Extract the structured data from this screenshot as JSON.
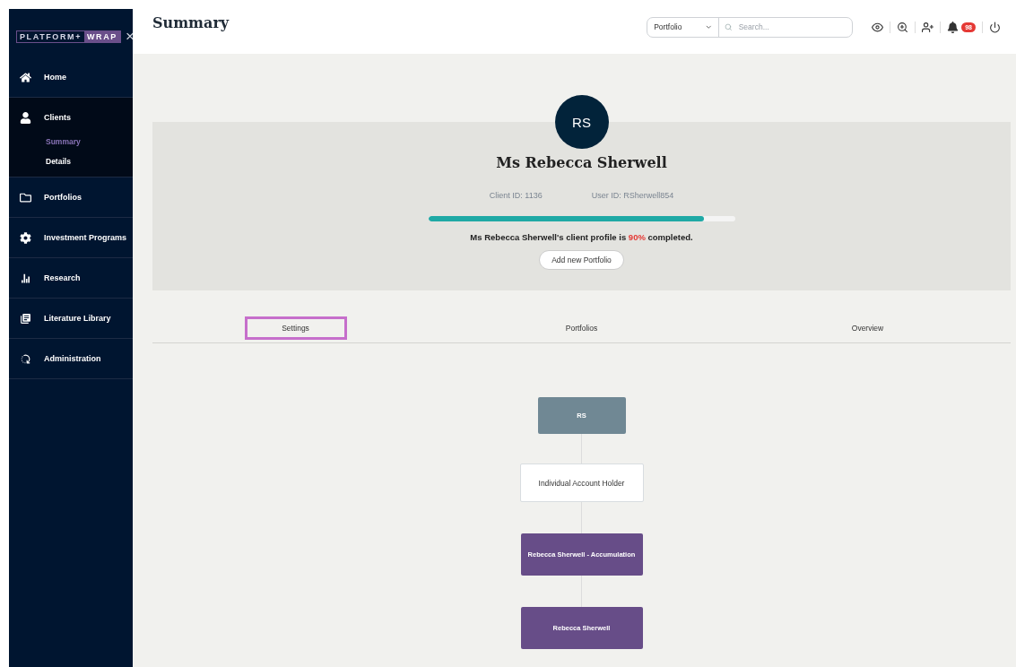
{
  "logo": {
    "left": "PLATFORM",
    "plus": "+",
    "right": "WRAP",
    "close": "×"
  },
  "sidebar": {
    "items": [
      {
        "label": "Home",
        "expanded": false
      },
      {
        "label": "Clients",
        "expanded": true,
        "children": [
          {
            "label": "Summary",
            "selected": true
          },
          {
            "label": "Details",
            "selected": false
          }
        ]
      },
      {
        "label": "Portfolios",
        "expanded": false
      },
      {
        "label": "Investment Programs",
        "expanded": false
      },
      {
        "label": "Research",
        "expanded": false
      },
      {
        "label": "Literature Library",
        "expanded": false
      },
      {
        "label": "Administration",
        "expanded": false
      }
    ]
  },
  "header": {
    "title": "Summary",
    "scope": "Portfolio",
    "search_placeholder": "Search...",
    "notifications": "98"
  },
  "profile": {
    "initials": "RS",
    "name": "Ms Rebecca Sherwell",
    "client_id": "Client ID: 1136",
    "user_id": "User ID: RSherwell854",
    "level": 0.9,
    "completion": "Ms Rebecca Sherwell's client profile is **90%** completed.",
    "button": "Add new Portfolio"
  },
  "tabs": [
    {
      "label": "Settings",
      "selected": true
    },
    {
      "label": "Portfolios",
      "selected": false
    },
    {
      "label": "Overview",
      "selected": false
    }
  ],
  "tree": [
    {
      "kind": "root",
      "label": "RS"
    },
    {
      "kind": "holder",
      "label": "Individual Account Holder"
    },
    {
      "kind": "portfolio",
      "label": "Rebecca Sherwell - Accumulation"
    },
    {
      "kind": "portfolio",
      "label": "Rebecca Sherwell"
    }
  ]
}
